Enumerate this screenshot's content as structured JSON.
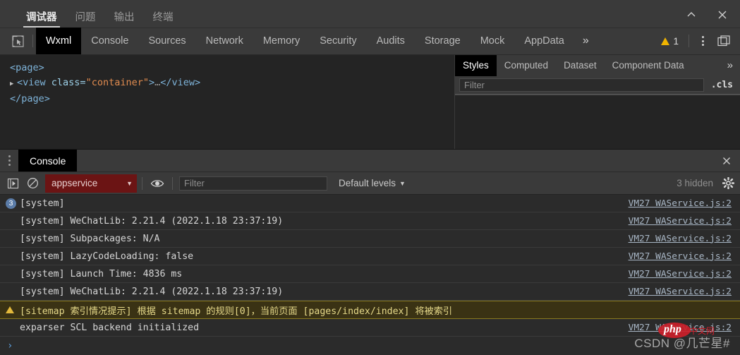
{
  "window": {
    "tabs": [
      {
        "label": "调试器",
        "active": true
      },
      {
        "label": "问题",
        "active": false
      },
      {
        "label": "输出",
        "active": false
      },
      {
        "label": "终端",
        "active": false
      }
    ],
    "controls": {
      "collapse": "chevron-up-icon",
      "close": "close-icon"
    }
  },
  "devtools": {
    "inspect_icon": "inspect-element-icon",
    "tabs": [
      {
        "label": "Wxml",
        "active": true
      },
      {
        "label": "Console",
        "active": false
      },
      {
        "label": "Sources",
        "active": false
      },
      {
        "label": "Network",
        "active": false
      },
      {
        "label": "Memory",
        "active": false
      },
      {
        "label": "Security",
        "active": false
      },
      {
        "label": "Audits",
        "active": false
      },
      {
        "label": "Storage",
        "active": false
      },
      {
        "label": "Mock",
        "active": false
      },
      {
        "label": "AppData",
        "active": false
      }
    ],
    "more_label": "»",
    "warning_count": "1",
    "kebab_icon": "more-options-icon",
    "dock_icon": "dock-position-icon"
  },
  "wxml": {
    "lines": [
      {
        "indent": 0,
        "arrow": false,
        "segments": [
          {
            "t": "<page>",
            "c": "tag"
          }
        ]
      },
      {
        "indent": 1,
        "arrow": true,
        "segments": [
          {
            "t": "<view ",
            "c": "tag"
          },
          {
            "t": "class=",
            "c": "attr"
          },
          {
            "t": "\"container\"",
            "c": "val"
          },
          {
            "t": ">",
            "c": "tag"
          },
          {
            "t": "…",
            "c": "dim"
          },
          {
            "t": "</view>",
            "c": "tag"
          }
        ]
      },
      {
        "indent": 0,
        "arrow": false,
        "segments": [
          {
            "t": "</page>",
            "c": "tag"
          }
        ]
      }
    ]
  },
  "styles_panel": {
    "tabs": [
      {
        "label": "Styles",
        "active": true
      },
      {
        "label": "Computed",
        "active": false
      },
      {
        "label": "Dataset",
        "active": false
      },
      {
        "label": "Component Data",
        "active": false
      }
    ],
    "more_label": "»",
    "filter_placeholder": "Filter",
    "cls_label": ".cls"
  },
  "drawer": {
    "handle_icon": "drag-handle-icon",
    "tab_label": "Console",
    "close_icon": "close-icon"
  },
  "console_toolbar": {
    "execute_icon": "execute-context-icon",
    "clear_icon": "clear-console-icon",
    "context_value": "appservice",
    "eye_icon": "live-expression-icon",
    "filter_placeholder": "Filter",
    "levels_label": "Default levels",
    "hidden_label": "3 hidden",
    "settings_icon": "gear-icon",
    "context_color": "#6b1414"
  },
  "console_logs": [
    {
      "badge": "3",
      "level": "info",
      "text": "[system]",
      "source": "VM27 WAService.js:2"
    },
    {
      "badge": null,
      "level": "log",
      "text": "[system] WeChatLib: 2.21.4 (2022.1.18 23:37:19)",
      "source": "VM27 WAService.js:2"
    },
    {
      "badge": null,
      "level": "log",
      "text": "[system] Subpackages: N/A",
      "source": "VM27 WAService.js:2"
    },
    {
      "badge": null,
      "level": "log",
      "text": "[system] LazyCodeLoading: false",
      "source": "VM27 WAService.js:2"
    },
    {
      "badge": null,
      "level": "log",
      "text": "[system] Launch Time: 4836 ms",
      "source": "VM27 WAService.js:2"
    },
    {
      "badge": null,
      "level": "log",
      "text": "[system] WeChatLib: 2.21.4 (2022.1.18 23:37:19)",
      "source": "VM27 WAService.js:2"
    },
    {
      "badge": null,
      "level": "warn",
      "text": "[sitemap 索引情况提示] 根据 sitemap 的规则[0]，当前页面 [pages/index/index] 将被索引",
      "source": ""
    },
    {
      "badge": null,
      "level": "log",
      "text": "exparser SCL backend initialized",
      "source": "VM27 WAService.js:2"
    }
  ],
  "console_prompt": {
    "marker": "›",
    "value": ""
  },
  "watermark": {
    "text": "CSDN @几芒星#",
    "logo_text": "php",
    "logo_cn": "中文网",
    "logo_color": "#cc1f2a"
  }
}
